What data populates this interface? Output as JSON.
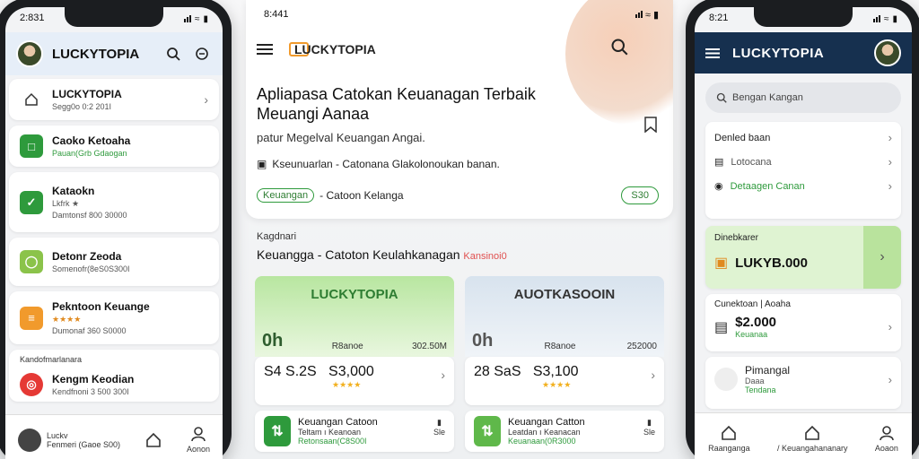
{
  "left_phone": {
    "status_time": "2:831",
    "header_title": "LUCKYTOPIA",
    "list": [
      {
        "title": "LUCKYTOPIA",
        "subtitle": "Segg0o 0:2 201I",
        "icon": "home-icon",
        "sub_color": "gray"
      },
      {
        "title": "Caoko Ketoaha",
        "subtitle": "Pauan(Grb Gdaogan",
        "icon": "wallet-icon",
        "sub_color": "green"
      },
      {
        "title": "Kataokn",
        "subtitle": "Lkfrk ★",
        "subtitle2": "Damtonsf 800 30000",
        "icon": "chart-icon",
        "sub_color": "gray"
      },
      {
        "title": "Detonr Zeoda",
        "subtitle": "Somenofr(8eS0S300I",
        "icon": "coin-icon",
        "sub_color": "gray"
      },
      {
        "title": "Pekntoon Keuange",
        "subtitle": "★★★★",
        "subtitle2": "Dumonaf 360 S0000",
        "icon": "calc-icon",
        "sub_color": "orange"
      },
      {
        "title": "Kengm Keodian",
        "subtitle": "Kendfnoni 3 500 300I",
        "label_above": "Kandofmarlanara",
        "icon": "target-icon",
        "sub_color": "gray"
      }
    ],
    "nav": [
      {
        "label_top": "Luckv",
        "label": "Fenmeri (Gaoe S00)",
        "icon": "logo-icon"
      },
      {
        "label": "",
        "icon": "home-icon"
      },
      {
        "label": "Aonon",
        "icon": "user-icon"
      }
    ]
  },
  "center": {
    "status_time": "8:441",
    "brand": "LUCKYTOPIA",
    "headline": "Apliapasa Catokan Keuanagan Terbaik Meuangi Aanaa",
    "sub": "patur Megelval Keuangan Angai.",
    "line": "Kseunuarlan - Catonana Glakolonoukan banan.",
    "tag_pill": "Keuangan",
    "tag_text": "- Catoon Kelanga",
    "button": "S30",
    "section_label": "Kagdnari",
    "section_title": "Keuangga - Catoton Keulahkanagan",
    "section_badge": "Kansinoi0",
    "tiles": [
      {
        "name": "LUCKYTOPIA",
        "big": "0h",
        "mid": "R8anoe",
        "right": "302.50M",
        "price_left": "S4 S.2S",
        "price_right": "S3,000",
        "stars": "★★★★",
        "app_title": "Keuangan Catoon",
        "app_line2": "Teltam ı Keanoan",
        "app_line3": "Retonsaan(C8S00I",
        "del_label": "Sle",
        "accent": "#2e7d32"
      },
      {
        "name": "AUOTKASOOIN",
        "big": "0h",
        "mid": "R8anoe",
        "right": "252000",
        "price_left": "28 SaS",
        "price_right": "S3,100",
        "stars": "★★★★",
        "app_title": "Keuangan Catton",
        "app_line2": "Leatdan ı Keanacan",
        "app_line3": "Keuanaan(0R3000",
        "del_label": "Sle",
        "accent": "#555555"
      }
    ]
  },
  "right_phone": {
    "status_time": "8:21",
    "header_title": "LUCKYTOPIA",
    "search_placeholder": "Bengan Kangan",
    "card1": {
      "title": "Denled baan",
      "rows": [
        "Lotocana",
        "Detaagen Canan"
      ]
    },
    "card2": {
      "label": "Dinebkarer",
      "value": "LUKYB.000"
    },
    "card3": {
      "label": "Cunektoan | Aoaha",
      "value": "$2.000",
      "sub": "Keuanaa"
    },
    "card4": {
      "title": "Pimangal",
      "line2": "Daaa",
      "line3": "Tendana"
    },
    "nav": [
      {
        "label": "Raanganga",
        "icon": "home-icon"
      },
      {
        "label": "/ Keuangahananary",
        "icon": "home-icon"
      },
      {
        "label": "Aoaon",
        "icon": "user-icon"
      }
    ]
  },
  "colors": {
    "green": "#2e9a3c",
    "navy": "#16304f",
    "orange": "#f19a2c"
  }
}
